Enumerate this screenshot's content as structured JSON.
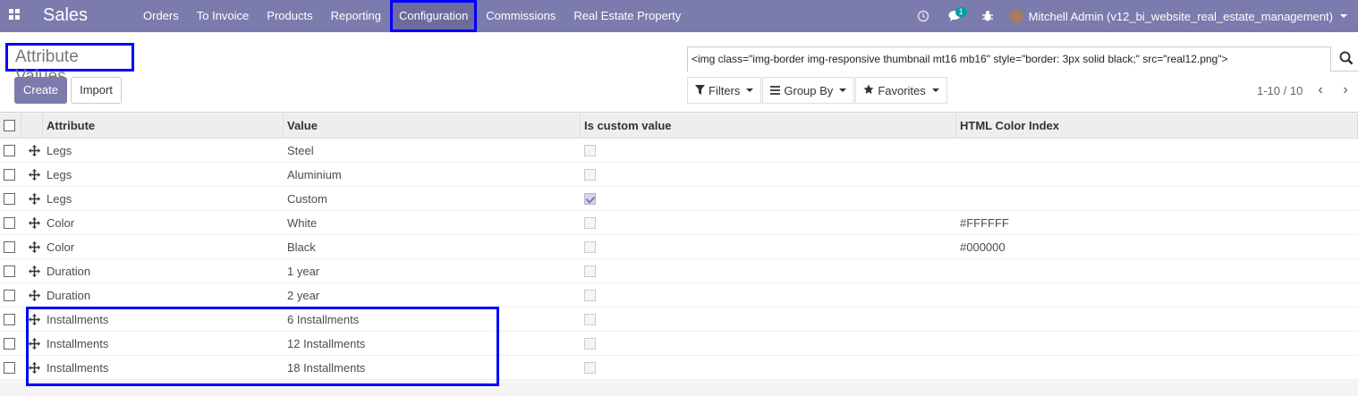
{
  "navbar": {
    "brand": "Sales",
    "menu": [
      "Orders",
      "To Invoice",
      "Products",
      "Reporting",
      "Configuration",
      "Commissions",
      "Real Estate Property"
    ],
    "active_index": 4,
    "icons": [
      "clock-icon",
      "chat-icon",
      "bug-icon"
    ],
    "chat_badge": "1",
    "user": "Mitchell Admin (v12_bi_website_real_estate_management)"
  },
  "control": {
    "title": "Attribute Values",
    "create_label": "Create",
    "import_label": "Import",
    "search_value": "<img class=\"img-border img-responsive thumbnail mt16 mb16\" style=\"border: 3px solid black;\" src=\"real12.png\">",
    "filters_label": "Filters",
    "groupby_label": "Group By",
    "favorites_label": "Favorites",
    "pager": "1-10 / 10"
  },
  "table": {
    "headers": [
      "Attribute",
      "Value",
      "Is custom value",
      "HTML Color Index"
    ],
    "rows": [
      {
        "attribute": "Legs",
        "value": "Steel",
        "custom": false,
        "color": ""
      },
      {
        "attribute": "Legs",
        "value": "Aluminium",
        "custom": false,
        "color": ""
      },
      {
        "attribute": "Legs",
        "value": "Custom",
        "custom": true,
        "color": ""
      },
      {
        "attribute": "Color",
        "value": "White",
        "custom": false,
        "color": "#FFFFFF"
      },
      {
        "attribute": "Color",
        "value": "Black",
        "custom": false,
        "color": "#000000"
      },
      {
        "attribute": "Duration",
        "value": "1 year",
        "custom": false,
        "color": ""
      },
      {
        "attribute": "Duration",
        "value": "2 year",
        "custom": false,
        "color": ""
      },
      {
        "attribute": "Installments",
        "value": "6 Installments",
        "custom": false,
        "color": ""
      },
      {
        "attribute": "Installments",
        "value": "12 Installments",
        "custom": false,
        "color": ""
      },
      {
        "attribute": "Installments",
        "value": "18 Installments",
        "custom": false,
        "color": ""
      }
    ]
  },
  "colors": {
    "brand": "#7c7bad",
    "highlight": "#0000ff"
  }
}
